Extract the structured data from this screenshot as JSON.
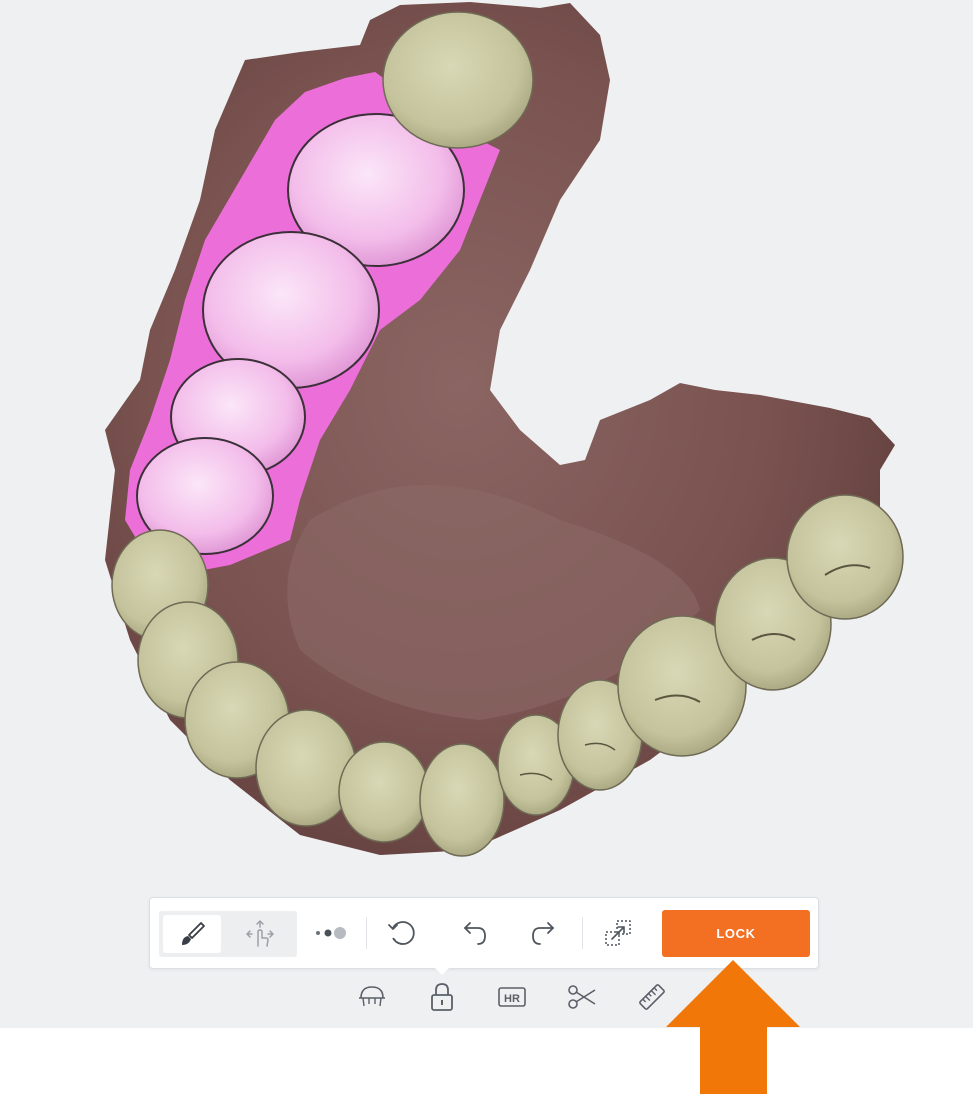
{
  "toolbar": {
    "mode_tools": [
      {
        "name": "brush-tool",
        "icon": "brush-icon",
        "active": true
      },
      {
        "name": "move-tool",
        "icon": "move-gesture-icon",
        "active": false
      }
    ],
    "brush_size_icon": "brush-size-icon",
    "reset_icon": "reset-icon",
    "undo_icon": "undo-icon",
    "redo_icon": "redo-icon",
    "expand_icon": "expand-selection-icon",
    "lock_label": "LOCK",
    "accent_color": "#f36f21"
  },
  "bottom_tools": [
    {
      "icon": "jaw-icon"
    },
    {
      "icon": "lock-icon",
      "selected": true
    },
    {
      "icon": "hr-icon",
      "label": "HR"
    },
    {
      "icon": "scissors-icon"
    },
    {
      "icon": "ruler-icon"
    }
  ],
  "annotation": {
    "icon": "arrow-up-icon",
    "color": "#f07708"
  },
  "scan": {
    "gum_color": "#7a5350",
    "tooth_color": "#c9c8a1",
    "locked_color": "#ec6fd9"
  }
}
